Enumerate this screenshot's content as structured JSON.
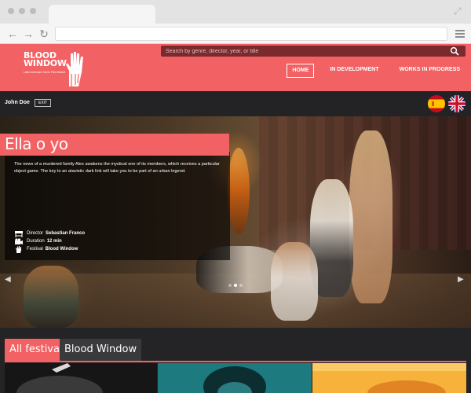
{
  "site": {
    "logo_text_line1": "BLOOD",
    "logo_text_line2": "WINDOW",
    "logo_subtext": "Latin American Genre Film Market",
    "search_placeholder": "Search by genre, director, year, or title",
    "menu": [
      "HOME",
      "IN DEVELOPMENT",
      "WORKS IN PROGRESS"
    ],
    "active_menu": "HOME"
  },
  "user": {
    "name": "John Doe",
    "exit_label": "EXIT"
  },
  "languages": [
    "spanish-flag-icon",
    "uk-flag-icon"
  ],
  "hero": {
    "title": "Ella o yo",
    "description": "The news of a murdered family Alex awakens the mystical one of its members, which receives a particular object game. The key to an atavistic dark link will take you to be part of an urban legend.",
    "director_label": "Director",
    "director_value": "Sebastian Franco",
    "duration_label": "Duration",
    "duration_value": "12 min",
    "festival_label": "Festival",
    "festival_value": "Blood Window",
    "carousel_pages": 3,
    "carousel_active": 2
  },
  "festival_tabs": [
    "All festivals",
    "Blood Window"
  ],
  "colors": {
    "brand": "#f26163",
    "dark": "#1d1d1f"
  }
}
